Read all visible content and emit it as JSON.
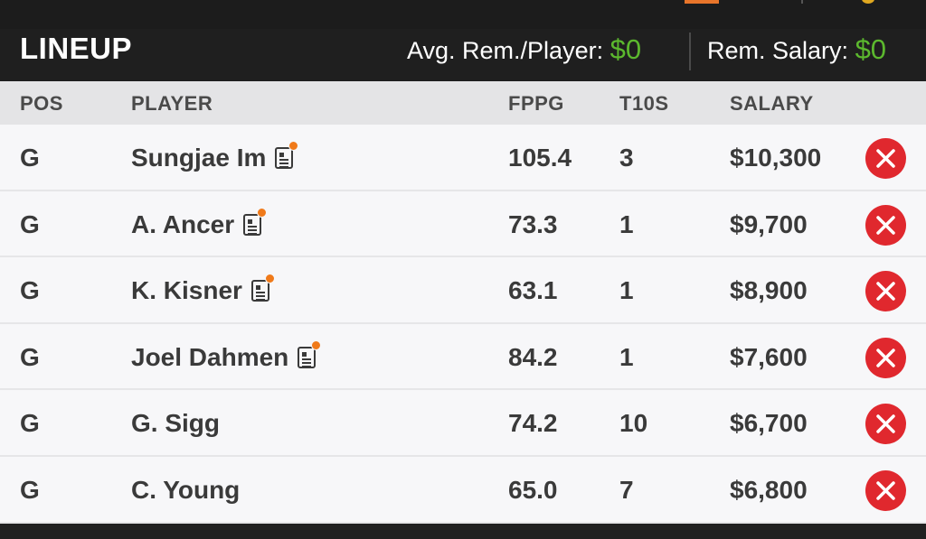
{
  "header": {
    "title": "LINEUP",
    "avg_label": "Avg. Rem./Player:",
    "avg_value": "$0",
    "rem_label": "Rem. Salary:",
    "rem_value": "$0"
  },
  "columns": {
    "pos": "POS",
    "player": "PLAYER",
    "fppg": "FPPG",
    "t10s": "T10S",
    "salary": "SALARY"
  },
  "rows": [
    {
      "pos": "G",
      "player": "Sungjae Im",
      "news": true,
      "fppg": "105.4",
      "t10s": "3",
      "salary": "$10,300"
    },
    {
      "pos": "G",
      "player": "A. Ancer",
      "news": true,
      "fppg": "73.3",
      "t10s": "1",
      "salary": "$9,700"
    },
    {
      "pos": "G",
      "player": "K. Kisner",
      "news": true,
      "fppg": "63.1",
      "t10s": "1",
      "salary": "$8,900"
    },
    {
      "pos": "G",
      "player": "Joel Dahmen",
      "news": true,
      "fppg": "84.2",
      "t10s": "1",
      "salary": "$7,600"
    },
    {
      "pos": "G",
      "player": "G. Sigg",
      "news": false,
      "fppg": "74.2",
      "t10s": "10",
      "salary": "$6,700"
    },
    {
      "pos": "G",
      "player": "C. Young",
      "news": false,
      "fppg": "65.0",
      "t10s": "7",
      "salary": "$6,800"
    }
  ],
  "icons": {
    "news": "player-news-icon",
    "remove": "remove-player-icon"
  },
  "colors": {
    "accent_green": "#5cb82e",
    "remove_red": "#e0282e",
    "news_dot": "#f07a1a"
  }
}
